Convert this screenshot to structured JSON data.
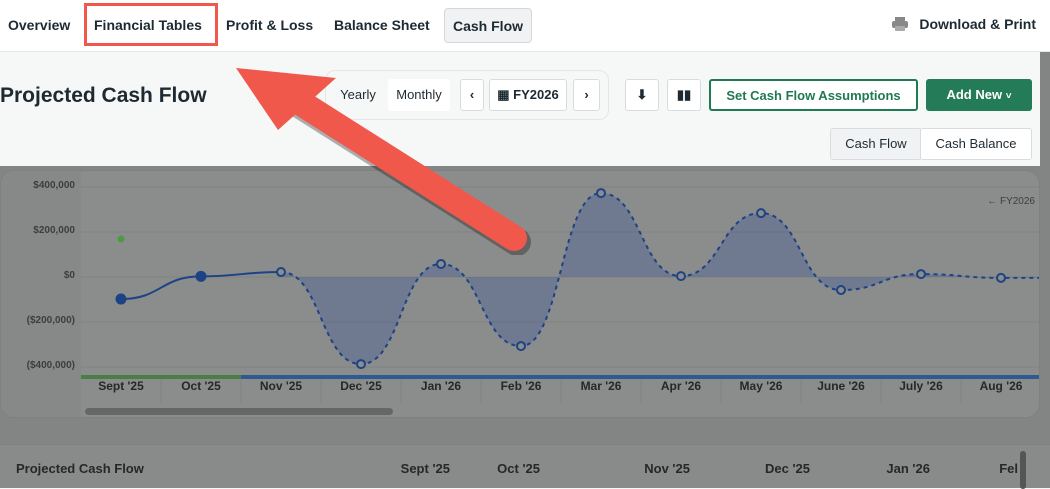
{
  "nav": {
    "tabs": [
      "Overview",
      "Financial Tables",
      "Profit & Loss",
      "Balance Sheet",
      "Cash Flow"
    ],
    "active": "Cash Flow",
    "download": "Download & Print"
  },
  "header": {
    "title": "Projected Cash Flow",
    "yearly": "Yearly",
    "monthly": "Monthly",
    "period": "FY2026",
    "assumptions": "Set Cash Flow Assumptions",
    "add_new": "Add New",
    "toggle": [
      "Cash Flow",
      "Cash Balance"
    ]
  },
  "chart_data": {
    "type": "line",
    "title": "",
    "x": [
      "Sept '25",
      "Oct '25",
      "Nov '25",
      "Dec '25",
      "Jan '26",
      "Feb '26",
      "Mar '26",
      "Apr '26",
      "May '26",
      "June '26",
      "July '26",
      "Aug '26"
    ],
    "series": [
      {
        "name": "Cash Flow",
        "values": [
          -98000,
          3000,
          22000,
          -387000,
          58000,
          -307000,
          373000,
          4000,
          284000,
          -58000,
          13000,
          -4000
        ],
        "actual_count": 2,
        "color": "#1f4f9c"
      },
      {
        "name": "Actual marker",
        "values": [
          169000
        ],
        "color": "#5aaa4a"
      }
    ],
    "ylim": [
      -450000,
      450000
    ],
    "yticks": [
      400000,
      200000,
      0,
      -200000,
      -400000
    ],
    "ytick_labels": [
      "$400,000",
      "$200,000",
      "$0",
      "($200,000)",
      "($400,000)"
    ],
    "annotation": "← FY2026"
  },
  "table": {
    "title": "Projected Cash Flow",
    "columns": [
      "Sept '25",
      "Oct '25",
      "Nov '25",
      "Dec '25",
      "Jan '26",
      "Fel"
    ]
  }
}
